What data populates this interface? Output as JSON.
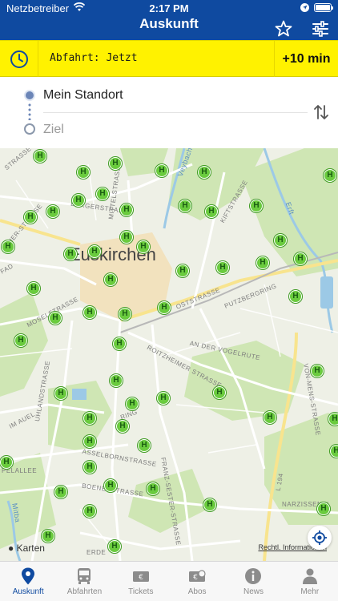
{
  "status": {
    "carrier": "Netzbetreiber",
    "time": "2:17 PM"
  },
  "nav": {
    "title": "Auskunft"
  },
  "departure": {
    "label": "Abfahrt: Jetzt",
    "plus_button": "+10 min"
  },
  "route": {
    "from": "Mein Standort",
    "to_placeholder": "Ziel"
  },
  "map": {
    "city_label": "Euskirchen",
    "attribution": "Karten",
    "legal_link": "Rechtl. Informationen",
    "stop_icon_letter": "H",
    "streets": {
      "strasse": "STRASSE",
      "bergerstrasse": "BERGERSTRASSE",
      "mittelstrasse": "MITTELSTRASSE",
      "oststrasse": "OSTSTRASSE",
      "putzbergring": "PUTZBERGRING",
      "roitzheimer": "ROITZHEIMER STRASSE",
      "vogelrute": "AN DER VOGELRUTE",
      "moselstrasse": "MOSELSTRASSE",
      "uhlandstrasse": "UHLANDSTRASSE",
      "imauel": "IM AUEL",
      "pelallee": "PELALLEE",
      "asselbornstrasse": "ASSELBORNSTRASSE",
      "boenerstrasse": "BOENERSTRASSE",
      "franzsesterstrasse": "FRANZ-SESTER-STRASSE",
      "narzissenweg": "NARZISSENW",
      "erde": "ERDE",
      "ring": "RING",
      "erft": "Erft",
      "veybach": "Veybach",
      "mitbach": "Mitba",
      "l194": "L 194",
      "herstrasse": "HER-STRASSE",
      "fad": "FAD",
      "kiftstrasse": "KIFTSTRASSE",
      "vonmenstrasse": "VON-MENS-STRASSE"
    }
  },
  "tabs": [
    {
      "label": "Auskunft",
      "icon": "pin-icon"
    },
    {
      "label": "Abfahrten",
      "icon": "bus-icon"
    },
    {
      "label": "Tickets",
      "icon": "ticket-icon"
    },
    {
      "label": "Abos",
      "icon": "subscription-icon"
    },
    {
      "label": "News",
      "icon": "info-icon"
    },
    {
      "label": "Mehr",
      "icon": "person-icon"
    }
  ],
  "colors": {
    "brand": "#0f4aa0",
    "departure_bar": "#fff200",
    "stop": "#6acb3e"
  }
}
